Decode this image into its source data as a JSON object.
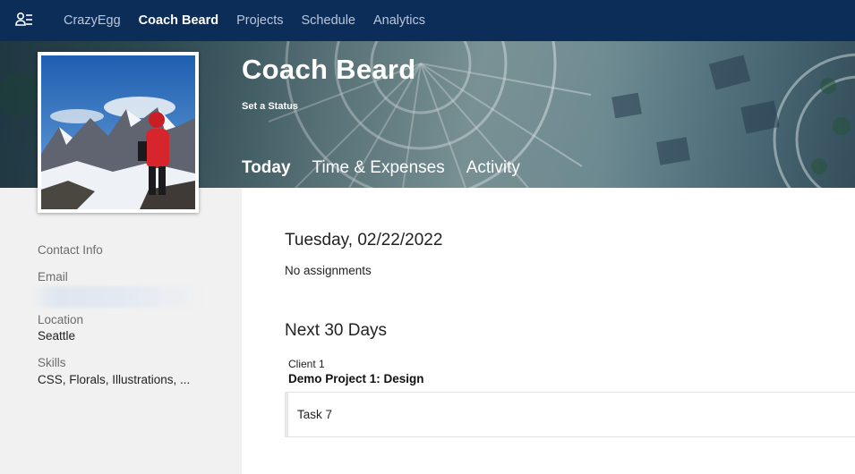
{
  "nav": {
    "items": [
      {
        "label": "CrazyEgg",
        "active": false
      },
      {
        "label": "Coach Beard",
        "active": true
      },
      {
        "label": "Projects",
        "active": false
      },
      {
        "label": "Schedule",
        "active": false
      },
      {
        "label": "Analytics",
        "active": false
      }
    ],
    "logo_icon": "people-icon"
  },
  "profile": {
    "name": "Coach Beard",
    "status_link": "Set a Status",
    "tabs": [
      {
        "label": "Today",
        "active": true
      },
      {
        "label": "Time & Expenses",
        "active": false
      },
      {
        "label": "Activity",
        "active": false
      }
    ]
  },
  "sidebar": {
    "contact_label": "Contact Info",
    "email_label": "Email",
    "location_label": "Location",
    "location_value": "Seattle",
    "skills_label": "Skills",
    "skills_value": "CSS, Florals, Illustrations, ..."
  },
  "main": {
    "date_heading": "Tuesday, 02/22/2022",
    "no_assignments": "No assignments",
    "next_heading": "Next 30 Days",
    "client": "Client 1",
    "project": "Demo Project 1: Design",
    "task": "Task 7"
  },
  "colors": {
    "nav_bg": "#0d2d59",
    "nav_text": "#b8c7dc",
    "sidebar_bg": "#f1f1f1"
  }
}
